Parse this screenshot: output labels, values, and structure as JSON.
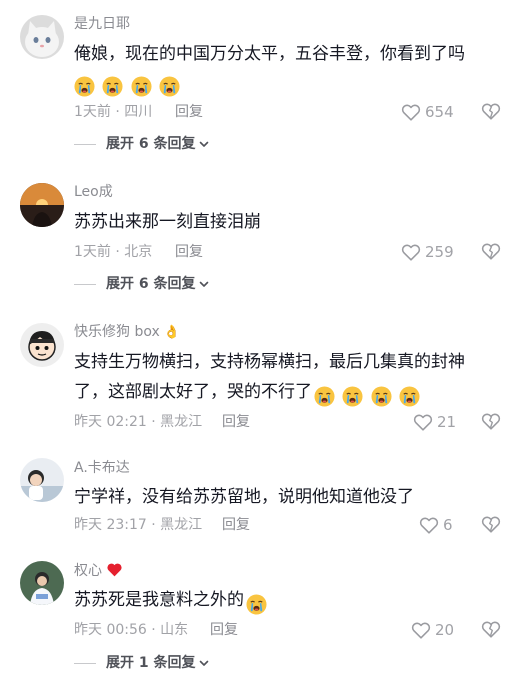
{
  "comments": [
    {
      "username": "是九日耶",
      "text": "俺娘，现在的中国万分太平，五谷丰登，你看到了吗",
      "emoji_count": 4,
      "time_location": "1天前 · 四川",
      "reply_label": "回复",
      "likes": "654",
      "expand_label": "展开 6 条回复"
    },
    {
      "username": "Leo成",
      "text": "苏苏出来那一刻直接泪崩",
      "emoji_count": 0,
      "time_location": "1天前 · 北京",
      "reply_label": "回复",
      "likes": "259",
      "expand_label": "展开 6 条回复"
    },
    {
      "username": "快乐修狗 box",
      "text_line1": "支持生万物横扫，支持杨幂横扫，最后几集真的封神",
      "text_line2": "了，这部剧太好了，哭的不行了",
      "emoji_count": 4,
      "time_location": "昨天 02:21 · 黑龙江",
      "reply_label": "回复",
      "likes": "21"
    },
    {
      "username": "A.卡布达",
      "text": "宁学祥，没有给苏苏留地，说明他知道他没了",
      "emoji_count": 0,
      "time_location": "昨天 23:17 · 黑龙江",
      "reply_label": "回复",
      "likes": "6"
    },
    {
      "username": "权心",
      "text": "苏苏死是我意料之外的",
      "emoji_count": 1,
      "time_location": "昨天 00:56 · 山东",
      "reply_label": "回复",
      "likes": "20",
      "expand_label": "展开 1 条回复"
    }
  ],
  "icons": {
    "like": "heart-outline-icon",
    "dislike": "broken-heart-icon",
    "expand": "chevron-down-icon",
    "emoji": "crying-face-emoji",
    "username_heart": "red-heart-emoji",
    "username_hand": "ok-hand-emoji"
  },
  "colors": {
    "text": "#161823",
    "secondary": "#a1a2a7",
    "username": "#8a8b91",
    "heart_red": "#e5202e"
  }
}
